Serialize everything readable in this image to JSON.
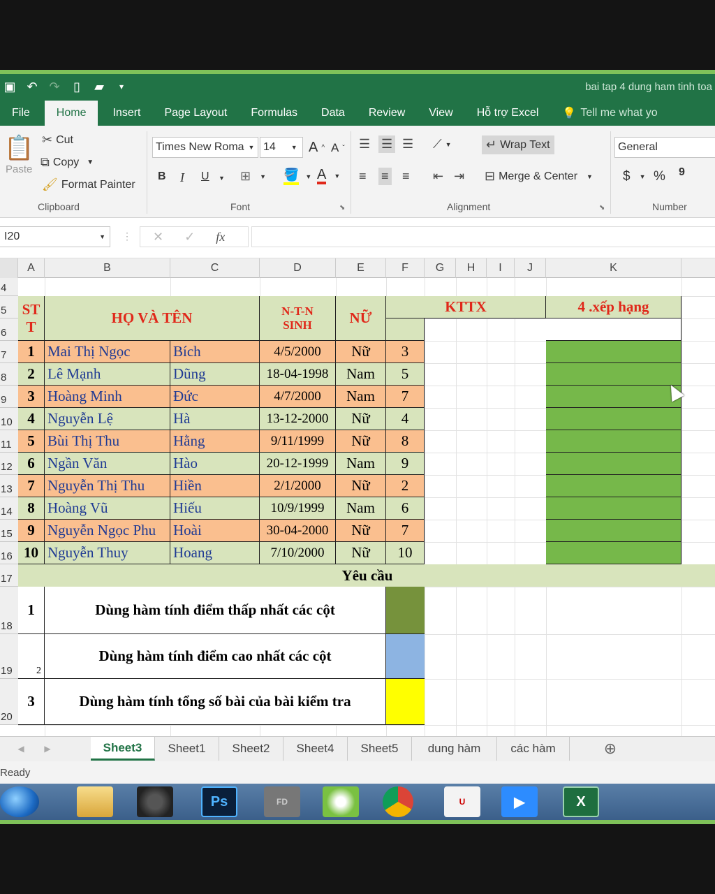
{
  "window": {
    "document_title": "bai tap 4 dung ham tinh toa"
  },
  "qat": {
    "save_icon": "save-icon",
    "undo_icon": "undo-icon",
    "redo_icon": "redo-icon",
    "new_icon": "new-file-icon",
    "open_icon": "open-folder-icon",
    "more_icon": "customize-icon"
  },
  "ribbon_tabs": [
    "File",
    "Home",
    "Insert",
    "Page Layout",
    "Formulas",
    "Data",
    "Review",
    "View",
    "Hỗ trợ Excel",
    "Tell me what yo"
  ],
  "clipboard": {
    "paste": "Paste",
    "cut": "Cut",
    "copy": "Copy",
    "format_painter": "Format Painter",
    "label": "Clipboard"
  },
  "font": {
    "name": "Times New Roma",
    "size": "14",
    "bold": "B",
    "italic": "I",
    "underline": "U",
    "label": "Font",
    "increase": "A",
    "decrease": "A",
    "font_color": "A"
  },
  "alignment": {
    "wrap_text": "Wrap Text",
    "merge_center": "Merge & Center",
    "label": "Alignment"
  },
  "number": {
    "format": "General",
    "currency": "$",
    "percent": "%",
    "comma": "9",
    "label": "Number"
  },
  "formula_bar": {
    "name_box": "I20",
    "fx": "fx",
    "cancel": "✕",
    "enter": "✓",
    "value": ""
  },
  "columns": [
    "A",
    "B",
    "C",
    "D",
    "E",
    "F",
    "G",
    "H",
    "I",
    "J",
    "K"
  ],
  "row_numbers": [
    "4",
    "5",
    "6",
    "7",
    "8",
    "9",
    "10",
    "11",
    "12",
    "13",
    "14",
    "15",
    "16",
    "17",
    "18",
    "19",
    "20"
  ],
  "table_header": {
    "stt": "ST T",
    "ho_ten": "HỌ VÀ TÊN",
    "ntn": "N-T-N",
    "sinh": "SINH",
    "nu": "NỮ",
    "kttx": "KTTX",
    "xep_hang": "4 .xếp hạng"
  },
  "students": [
    {
      "stt": "1",
      "ho": "Mai Thị Ngọc",
      "ten": "Bích",
      "ngay_sinh": "4/5/2000",
      "gioi_tinh": "Nữ",
      "diem": "3"
    },
    {
      "stt": "2",
      "ho": "Lê Mạnh",
      "ten": "Dũng",
      "ngay_sinh": "18-04-1998",
      "gioi_tinh": "Nam",
      "diem": "5"
    },
    {
      "stt": "3",
      "ho": "Hoàng Minh",
      "ten": "Đức",
      "ngay_sinh": "4/7/2000",
      "gioi_tinh": "Nam",
      "diem": "7"
    },
    {
      "stt": "4",
      "ho": "Nguyễn Lệ",
      "ten": "Hà",
      "ngay_sinh": "13-12-2000",
      "gioi_tinh": "Nữ",
      "diem": "4"
    },
    {
      "stt": "5",
      "ho": "Bùi Thị Thu",
      "ten": "Hằng",
      "ngay_sinh": "9/11/1999",
      "gioi_tinh": "Nữ",
      "diem": "8"
    },
    {
      "stt": "6",
      "ho": "Ngần Văn",
      "ten": "Hào",
      "ngay_sinh": "20-12-1999",
      "gioi_tinh": "Nam",
      "diem": "9"
    },
    {
      "stt": "7",
      "ho": "Nguyễn Thị Thu",
      "ten": "Hiền",
      "ngay_sinh": "2/1/2000",
      "gioi_tinh": "Nữ",
      "diem": "2"
    },
    {
      "stt": "8",
      "ho": "Hoàng Vũ",
      "ten": "Hiếu",
      "ngay_sinh": "10/9/1999",
      "gioi_tinh": "Nam",
      "diem": "6"
    },
    {
      "stt": "9",
      "ho": "Nguyễn Ngọc Phu",
      "ten": "Hoài",
      "ngay_sinh": "30-04-2000",
      "gioi_tinh": "Nữ",
      "diem": "7"
    },
    {
      "stt": "10",
      "ho": "Nguyễn Thuy",
      "ten": "Hoang",
      "ngay_sinh": "7/10/2000",
      "gioi_tinh": "Nữ",
      "diem": "10"
    }
  ],
  "requirements_title": "Yêu cầu",
  "requirements": [
    {
      "num": "1",
      "text": "Dùng hàm tính  điểm thấp nhất các cột",
      "color": "#76923c"
    },
    {
      "num": "2",
      "text": "Dùng hàm tính  điểm cao nhất các cột",
      "color": "#8db4e2"
    },
    {
      "num": "3",
      "text": "Dùng hàm tính tổng số bài của bài kiểm tra",
      "color": "#ffff00"
    }
  ],
  "sheet_tabs": [
    "Sheet3",
    "Sheet1",
    "Sheet2",
    "Sheet4",
    "Sheet5",
    "dung hàm",
    "các hàm"
  ],
  "status": "Ready",
  "colors": {
    "excel_green": "#217346",
    "peach": "#fabf8f",
    "light_green": "#d8e4bc",
    "rank_green": "#76b84a",
    "header_red": "#e0281a",
    "name_blue": "#1f3a93"
  }
}
